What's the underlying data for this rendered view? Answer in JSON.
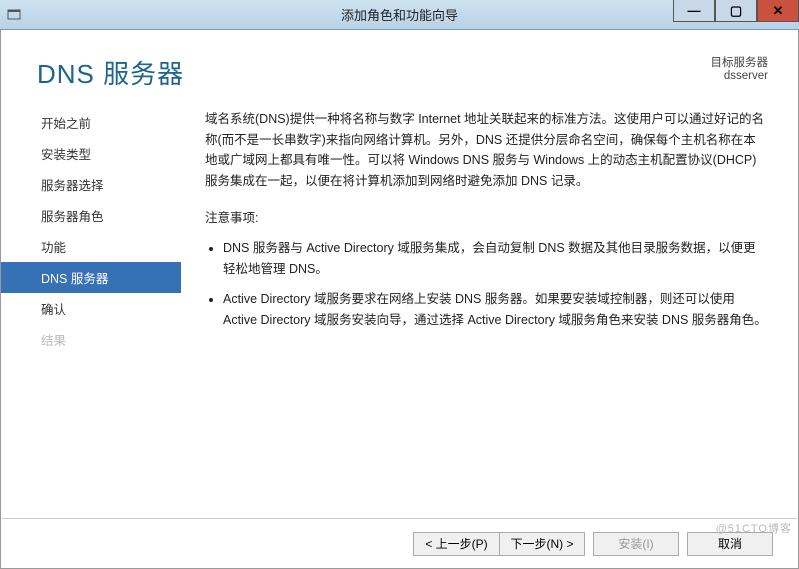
{
  "window": {
    "title": "添加角色和功能向导"
  },
  "header": {
    "page_title": "DNS 服务器",
    "target_label": "目标服务器",
    "target_value": "dsserver"
  },
  "sidebar": {
    "items": [
      {
        "label": "开始之前",
        "state": "normal"
      },
      {
        "label": "安装类型",
        "state": "normal"
      },
      {
        "label": "服务器选择",
        "state": "normal"
      },
      {
        "label": "服务器角色",
        "state": "normal"
      },
      {
        "label": "功能",
        "state": "normal"
      },
      {
        "label": "DNS 服务器",
        "state": "selected"
      },
      {
        "label": "确认",
        "state": "normal"
      },
      {
        "label": "结果",
        "state": "disabled"
      }
    ]
  },
  "content": {
    "intro": "域名系统(DNS)提供一种将名称与数字 Internet 地址关联起来的标准方法。这使用户可以通过好记的名称(而不是一长串数字)来指向网络计算机。另外，DNS 还提供分层命名空间，确保每个主机名称在本地或广域网上都具有唯一性。可以将 Windows DNS 服务与 Windows 上的动态主机配置协议(DHCP)服务集成在一起，以便在将计算机添加到网络时避免添加 DNS 记录。",
    "note_title": "注意事项:",
    "bullets": [
      "DNS 服务器与 Active Directory 域服务集成，会自动复制 DNS 数据及其他目录服务数据，以便更轻松地管理 DNS。",
      "Active Directory 域服务要求在网络上安装 DNS 服务器。如果要安装域控制器，则还可以使用 Active Directory 域服务安装向导，通过选择 Active Directory 域服务角色来安装 DNS 服务器角色。"
    ]
  },
  "footer": {
    "prev": "< 上一步(P)",
    "next": "下一步(N) >",
    "install": "安装(I)",
    "cancel": "取消"
  },
  "watermark": "@51CTO博客"
}
